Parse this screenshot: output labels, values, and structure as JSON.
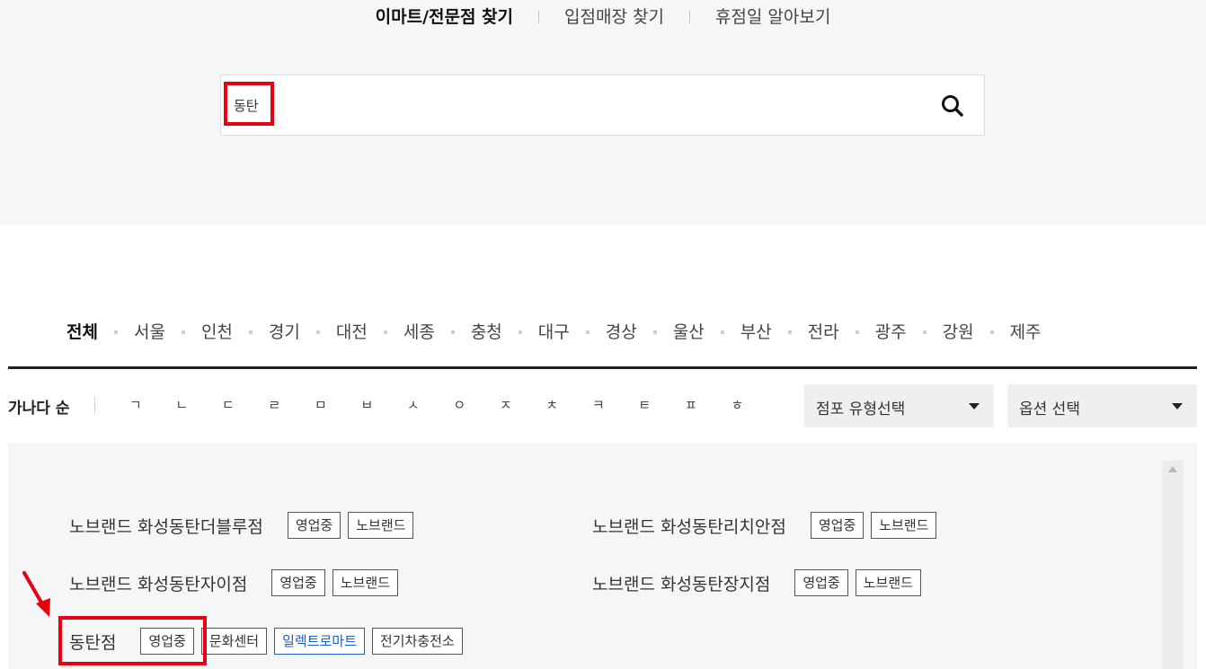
{
  "top_tabs": [
    {
      "label": "이마트/전문점 찾기",
      "active": true
    },
    {
      "label": "입점매장 찾기",
      "active": false
    },
    {
      "label": "휴점일 알아보기",
      "active": false
    }
  ],
  "search": {
    "value": "동탄",
    "icon": "search-icon"
  },
  "regions": [
    "전체",
    "서울",
    "인천",
    "경기",
    "대전",
    "세종",
    "충청",
    "대구",
    "경상",
    "울산",
    "부산",
    "전라",
    "광주",
    "강원",
    "제주"
  ],
  "filter": {
    "sort_label": "가나다 순",
    "consonants": [
      "ㄱ",
      "ㄴ",
      "ㄷ",
      "ㄹ",
      "ㅁ",
      "ㅂ",
      "ㅅ",
      "ㅇ",
      "ㅈ",
      "ㅊ",
      "ㅋ",
      "ㅌ",
      "ㅍ",
      "ㅎ"
    ],
    "store_type_select": "점포 유형선택",
    "option_select": "옵션 선택"
  },
  "stores": [
    {
      "name": "노브랜드 화성동탄더블루점",
      "tags": [
        "영업중",
        "노브랜드"
      ]
    },
    {
      "name": "노브랜드 화성동탄리치안점",
      "tags": [
        "영업중",
        "노브랜드"
      ]
    },
    {
      "name": "노브랜드 화성동탄자이점",
      "tags": [
        "영업중",
        "노브랜드"
      ]
    },
    {
      "name": "노브랜드 화성동탄장지점",
      "tags": [
        "영업중",
        "노브랜드"
      ]
    },
    {
      "name": "동탄점",
      "tags": [
        "영업중",
        "문화센터",
        "일렉트로마트",
        "전기차충전소"
      ]
    }
  ],
  "colors": {
    "highlight": "#e60012",
    "accent_blue": "#1a5fd0"
  }
}
